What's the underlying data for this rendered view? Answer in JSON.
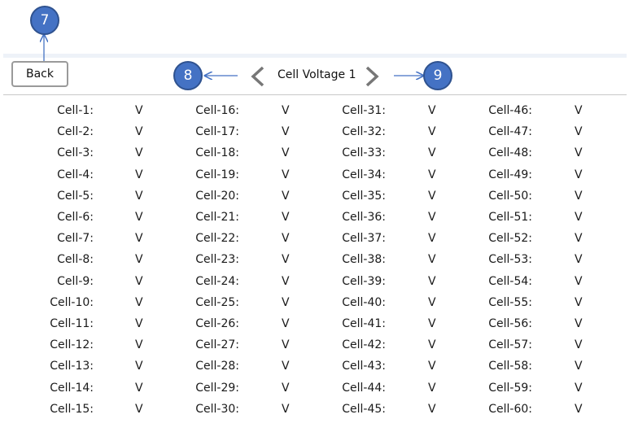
{
  "header": {
    "back_label": "Back",
    "title": "Cell Voltage 1",
    "prev_icon": "chevron-left-icon",
    "next_icon": "chevron-right-icon"
  },
  "callouts": {
    "back": "7",
    "prev": "8",
    "next": "9"
  },
  "colors": {
    "callout_fill": "#4472c4",
    "callout_border": "#2f528f",
    "chevron": "#777777"
  },
  "cells": {
    "unit": "V",
    "columns": [
      [
        "Cell-1:",
        "Cell-2:",
        "Cell-3:",
        "Cell-4:",
        "Cell-5:",
        "Cell-6:",
        "Cell-7:",
        "Cell-8:",
        "Cell-9:",
        "Cell-10:",
        "Cell-11:",
        "Cell-12:",
        "Cell-13:",
        "Cell-14:",
        "Cell-15:"
      ],
      [
        "Cell-16:",
        "Cell-17:",
        "Cell-18:",
        "Cell-19:",
        "Cell-20:",
        "Cell-21:",
        "Cell-22:",
        "Cell-23:",
        "Cell-24:",
        "Cell-25:",
        "Cell-26:",
        "Cell-27:",
        "Cell-28:",
        "Cell-29:",
        "Cell-30:"
      ],
      [
        "Cell-31:",
        "Cell-32:",
        "Cell-33:",
        "Cell-34:",
        "Cell-35:",
        "Cell-36:",
        "Cell-37:",
        "Cell-38:",
        "Cell-39:",
        "Cell-40:",
        "Cell-41:",
        "Cell-42:",
        "Cell-43:",
        "Cell-44:",
        "Cell-45:"
      ],
      [
        "Cell-46:",
        "Cell-47:",
        "Cell-48:",
        "Cell-49:",
        "Cell-50:",
        "Cell-51:",
        "Cell-52:",
        "Cell-53:",
        "Cell-54:",
        "Cell-55:",
        "Cell-56:",
        "Cell-57:",
        "Cell-58:",
        "Cell-59:",
        "Cell-60:"
      ]
    ]
  }
}
